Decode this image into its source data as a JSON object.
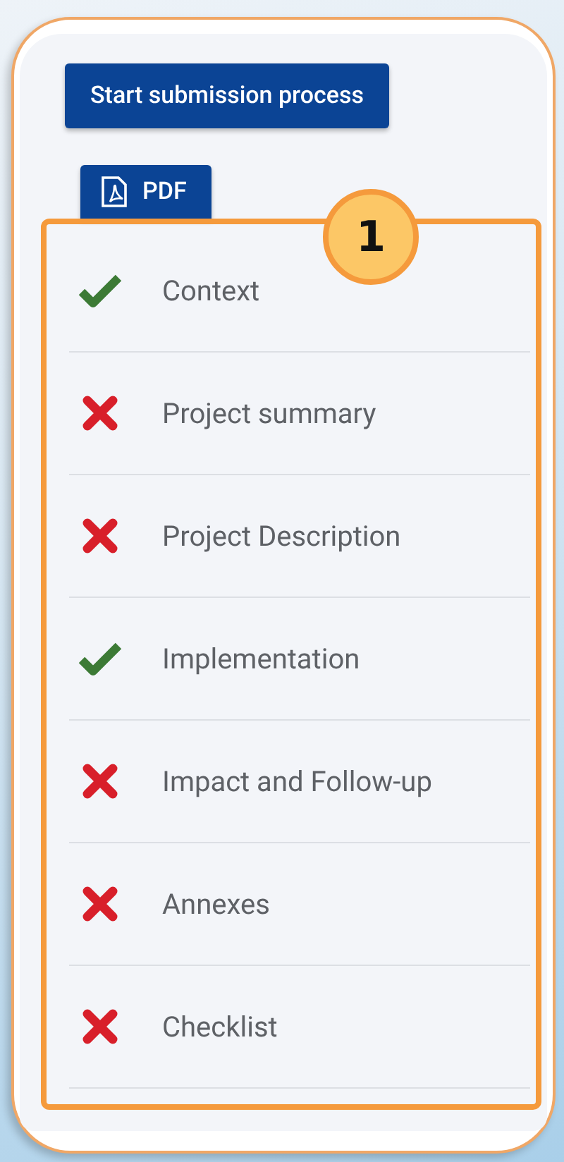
{
  "buttons": [
    {
      "label": "Start submission process",
      "kind": "primary"
    },
    {
      "label": "PDF",
      "kind": "pdf"
    }
  ],
  "callout": {
    "number": "1"
  },
  "sections": [
    {
      "label": "Context",
      "complete": true
    },
    {
      "label": "Project summary",
      "complete": false
    },
    {
      "label": "Project Description",
      "complete": false
    },
    {
      "label": "Implementation",
      "complete": true
    },
    {
      "label": "Impact and Follow-up",
      "complete": false
    },
    {
      "label": "Annexes",
      "complete": false
    },
    {
      "label": "Checklist",
      "complete": false
    }
  ]
}
